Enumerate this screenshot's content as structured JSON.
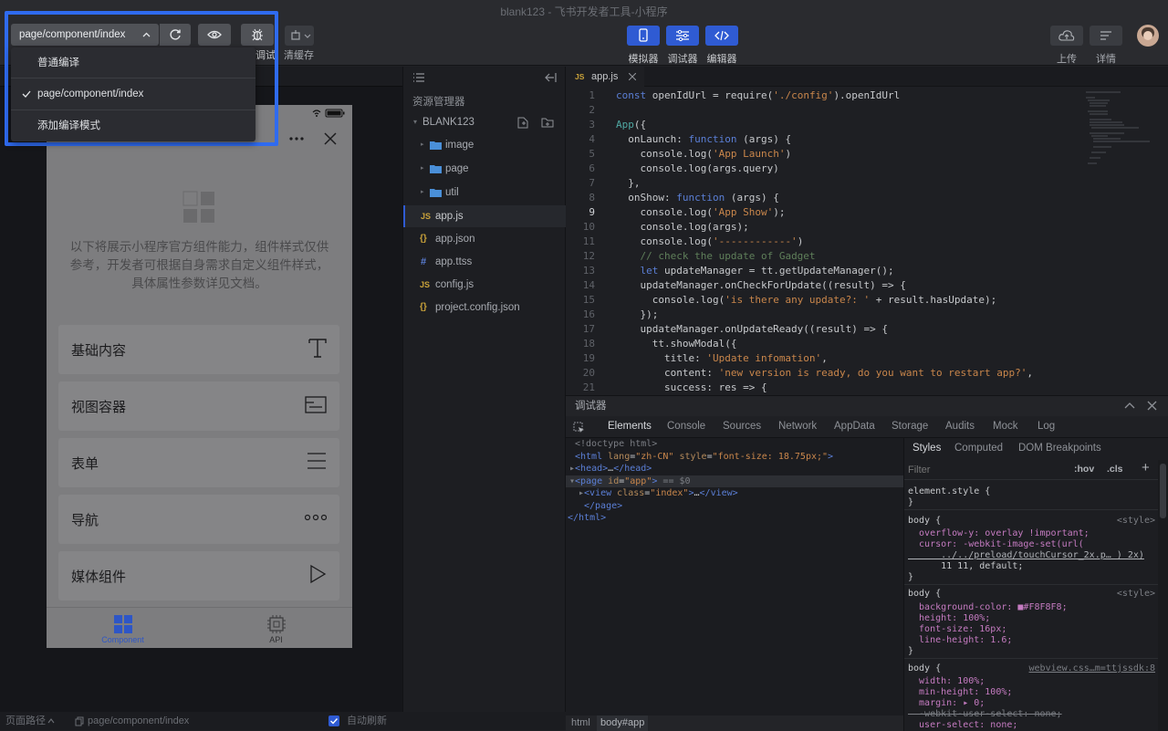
{
  "window": {
    "title": "blank123 - 飞书开发者工具-小程序"
  },
  "compile": {
    "mode_value": "page/component/index",
    "dropdown": [
      {
        "label": "普通编译",
        "checked": false
      },
      {
        "label": "page/component/index",
        "checked": true
      },
      {
        "label": "添加编译模式",
        "checked": false
      }
    ],
    "debug_label": "调试",
    "clear_cache_label": "清缓存"
  },
  "toolbar": {
    "simulator_label": "模拟器",
    "debugger_label": "调试器",
    "editor_label": "编辑器",
    "upload_label": "上传",
    "details_label": "详情"
  },
  "phone": {
    "intro": "以下将展示小程序官方组件能力，组件样式仅供参考，开发者可根据自身需求自定义组件样式，具体属性参数详见文档。",
    "menu": [
      {
        "label": "基础内容",
        "icon": "text-t-icon"
      },
      {
        "label": "视图容器",
        "icon": "window-icon"
      },
      {
        "label": "表单",
        "icon": "list-lines-icon"
      },
      {
        "label": "导航",
        "icon": "dots-icon"
      },
      {
        "label": "媒体组件",
        "icon": "play-icon"
      }
    ],
    "tabs": [
      {
        "label": "Component",
        "icon": "grid-icon",
        "active": true
      },
      {
        "label": "API",
        "icon": "chip-icon",
        "active": false
      }
    ]
  },
  "explorer": {
    "title": "资源管理器",
    "project": "BLANK123",
    "items": [
      {
        "name": "image",
        "kind": "folder"
      },
      {
        "name": "page",
        "kind": "folder"
      },
      {
        "name": "util",
        "kind": "folder"
      },
      {
        "name": "app.js",
        "kind": "js"
      },
      {
        "name": "app.json",
        "kind": "json"
      },
      {
        "name": "app.ttss",
        "kind": "ttss"
      },
      {
        "name": "config.js",
        "kind": "js"
      },
      {
        "name": "project.config.json",
        "kind": "json"
      }
    ]
  },
  "editor": {
    "tab": "app.js",
    "current_line": 9,
    "lines": [
      "const openIdUrl = require('./config').openIdUrl",
      "",
      "App({",
      "  onLaunch: function (args) {",
      "    console.log('App Launch')",
      "    console.log(args.query)",
      "  },",
      "  onShow: function (args) {",
      "    console.log('App Show');",
      "    console.log(args);",
      "    console.log('------------')",
      "    // check the update of Gadget",
      "    let updateManager = tt.getUpdateManager();",
      "    updateManager.onCheckForUpdate((result) => {",
      "      console.log('is there any update?: ' + result.hasUpdate);",
      "    });",
      "    updateManager.onUpdateReady((result) => {",
      "      tt.showModal({",
      "        title: 'Update infomation',",
      "        content: 'new version is ready, do you want to restart app?',",
      "        success: res => {"
    ]
  },
  "debugger": {
    "title": "调试器",
    "tabs": [
      "Elements",
      "Console",
      "Sources",
      "Network",
      "AppData",
      "Storage",
      "Audits",
      "Mock",
      "Log"
    ],
    "active_tab": "Elements",
    "dom": [
      "<!doctype html>",
      "<html lang=\"zh-CN\" style=\"font-size: 18.75px;\">",
      "▸<head>…</head>",
      "▾<page id=\"app\"> == $0",
      "  ▸<view class=\"index\">…</view>",
      "  </page>",
      "</html>"
    ],
    "styles_tabs": [
      "Styles",
      "Computed",
      "DOM Breakpoints"
    ],
    "filter_placeholder": "Filter",
    "hov": ":hov",
    "cls": ".cls",
    "style_lines": [
      "element.style {",
      "}",
      "body {",
      "  overflow-y: overlay !important;",
      "  cursor: -webkit-image-set(url(",
      "      ../../preload/touchCursor_2x.p… ) 2x)",
      "      11 11, default;",
      "}",
      "body {",
      "  background-color: ■#F8F8F8;",
      "  height: 100%;",
      "  font-size: 16px;",
      "  line-height: 1.6;",
      "}",
      "body {",
      "  width: 100%;",
      "  min-height: 100%;",
      "  margin: ▸ 0;",
      "  -webkit-user-select: none;",
      "  user-select: none;"
    ],
    "style_sources": [
      "<style>",
      "<style>",
      "webview.css…m=ttjssdk:8"
    ],
    "breadcrumb": [
      "html",
      "body#app"
    ]
  },
  "statusbar": {
    "path_label": "页面路径",
    "path_value": "page/component/index",
    "auto_refresh": "自动刷新"
  }
}
